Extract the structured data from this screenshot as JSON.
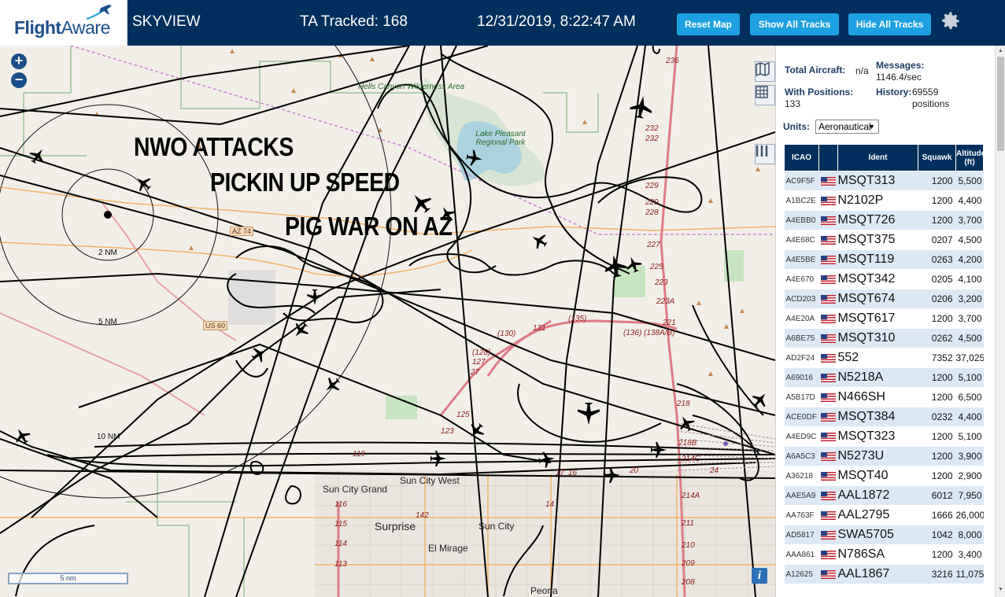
{
  "header": {
    "logo_flight": "Flight",
    "logo_aware": "Aware",
    "title": "SKYVIEW",
    "tracked": "TA Tracked: 168",
    "datetime": "12/31/2019, 8:22:47 AM",
    "reset_label": "Reset Map",
    "show_label": "Show All Tracks",
    "hide_label": "Hide All Tracks"
  },
  "colors": {
    "header_bg": "#002f5d",
    "button_bg": "#1da1e2",
    "table_header_bg": "#002f5d",
    "row_alt_bg": "#dce9f5"
  },
  "icons": {
    "gear": "gear-icon",
    "zoom_in": "zoom-in-icon",
    "zoom_out": "zoom-out-icon",
    "map_layers": "map-icon",
    "grid": "grid-icon",
    "columns": "columns-icon",
    "info": "info-icon"
  },
  "map": {
    "zoom_in": "+",
    "zoom_out": "−",
    "overlay_line1": "NWO ATTACKS",
    "overlay_line2": "PICKIN UP SPEED",
    "overlay_line3": "PIG WAR ON AZ",
    "ring_2nm": "2 NM",
    "ring_5nm": "5 NM",
    "ring_10nm": "10 NM",
    "scale": "5 nm",
    "info": "i",
    "labels": {
      "hells_canyon": "Hells Canyon Wilderness Area",
      "lake_pleasant": "Lake Pleasant Regional Park",
      "az74": "AZ 74",
      "us60": "US 60",
      "sun_city_grand": "Sun City Grand",
      "sun_city_west": "Sun City West",
      "surprise": "Surprise",
      "sun_city": "Sun City",
      "el_mirage": "El Mirage",
      "peoria": "Peoria"
    },
    "road_numbers": [
      "236",
      "232",
      "232",
      "229",
      "229",
      "228",
      "227",
      "225",
      "223",
      "223A",
      "221",
      "218",
      "218B",
      "214C",
      "214A",
      "211",
      "210",
      "209",
      "208",
      "(135)",
      "131",
      "(130)",
      "(136)",
      "(138A/B)",
      "(128)",
      "127",
      "27",
      "125",
      "123",
      "119",
      "116",
      "115",
      "114",
      "113",
      "142",
      "17",
      "16",
      "14",
      "20",
      "24"
    ]
  },
  "panel": {
    "total_aircraft_label": "Total Aircraft:",
    "total_aircraft_value": "n/a",
    "messages_label": "Messages:",
    "messages_value": "1146.4/sec",
    "with_positions_label": "With Positions:",
    "with_positions_value": "133",
    "history_label": "History:",
    "history_value": "69559 positions",
    "units_label": "Units:",
    "units_value": "Aeronautical",
    "columns": [
      "ICAO",
      "",
      "Ident",
      "Squawk",
      "Altitude (ft)"
    ],
    "rows": [
      {
        "icao": "AC9F5F",
        "ident": "MSQT313",
        "squawk": "1200",
        "alt": "5,500"
      },
      {
        "icao": "A1BC2E",
        "ident": "N2102P",
        "squawk": "1200",
        "alt": "4,400"
      },
      {
        "icao": "A4EBB0",
        "ident": "MSQT726",
        "squawk": "1200",
        "alt": "3,700"
      },
      {
        "icao": "A4E68C",
        "ident": "MSQT375",
        "squawk": "0207",
        "alt": "4,500"
      },
      {
        "icao": "A4E5BE",
        "ident": "MSQT119",
        "squawk": "0263",
        "alt": "4,200"
      },
      {
        "icao": "A4E670",
        "ident": "MSQT342",
        "squawk": "0205",
        "alt": "4,100"
      },
      {
        "icao": "ACD203",
        "ident": "MSQT674",
        "squawk": "0206",
        "alt": "3,200"
      },
      {
        "icao": "A4E20A",
        "ident": "MSQT617",
        "squawk": "1200",
        "alt": "3,700"
      },
      {
        "icao": "A6BE75",
        "ident": "MSQT310",
        "squawk": "0262",
        "alt": "4,500"
      },
      {
        "icao": "AD2F24",
        "ident": "552",
        "squawk": "7352",
        "alt": "37,025"
      },
      {
        "icao": "A69016",
        "ident": "N5218A",
        "squawk": "1200",
        "alt": "5,100"
      },
      {
        "icao": "A5B17D",
        "ident": "N466SH",
        "squawk": "1200",
        "alt": "6,500"
      },
      {
        "icao": "ACE0DF",
        "ident": "MSQT384",
        "squawk": "0232",
        "alt": "4,400"
      },
      {
        "icao": "A4ED9C",
        "ident": "MSQT323",
        "squawk": "1200",
        "alt": "5,100"
      },
      {
        "icao": "A6A5C3",
        "ident": "N5273U",
        "squawk": "1200",
        "alt": "3,900"
      },
      {
        "icao": "A36218",
        "ident": "MSQT40",
        "squawk": "1200",
        "alt": "2,900"
      },
      {
        "icao": "AAE5A9",
        "ident": "AAL1872",
        "squawk": "6012",
        "alt": "7,950"
      },
      {
        "icao": "AA763F",
        "ident": "AAL2795",
        "squawk": "1666",
        "alt": "26,000"
      },
      {
        "icao": "AD5817",
        "ident": "SWA5705",
        "squawk": "1042",
        "alt": "8,000"
      },
      {
        "icao": "AAA861",
        "ident": "N786SA",
        "squawk": "1200",
        "alt": "3,400"
      },
      {
        "icao": "A12625",
        "ident": "AAL1867",
        "squawk": "3216",
        "alt": "11,075"
      }
    ]
  }
}
